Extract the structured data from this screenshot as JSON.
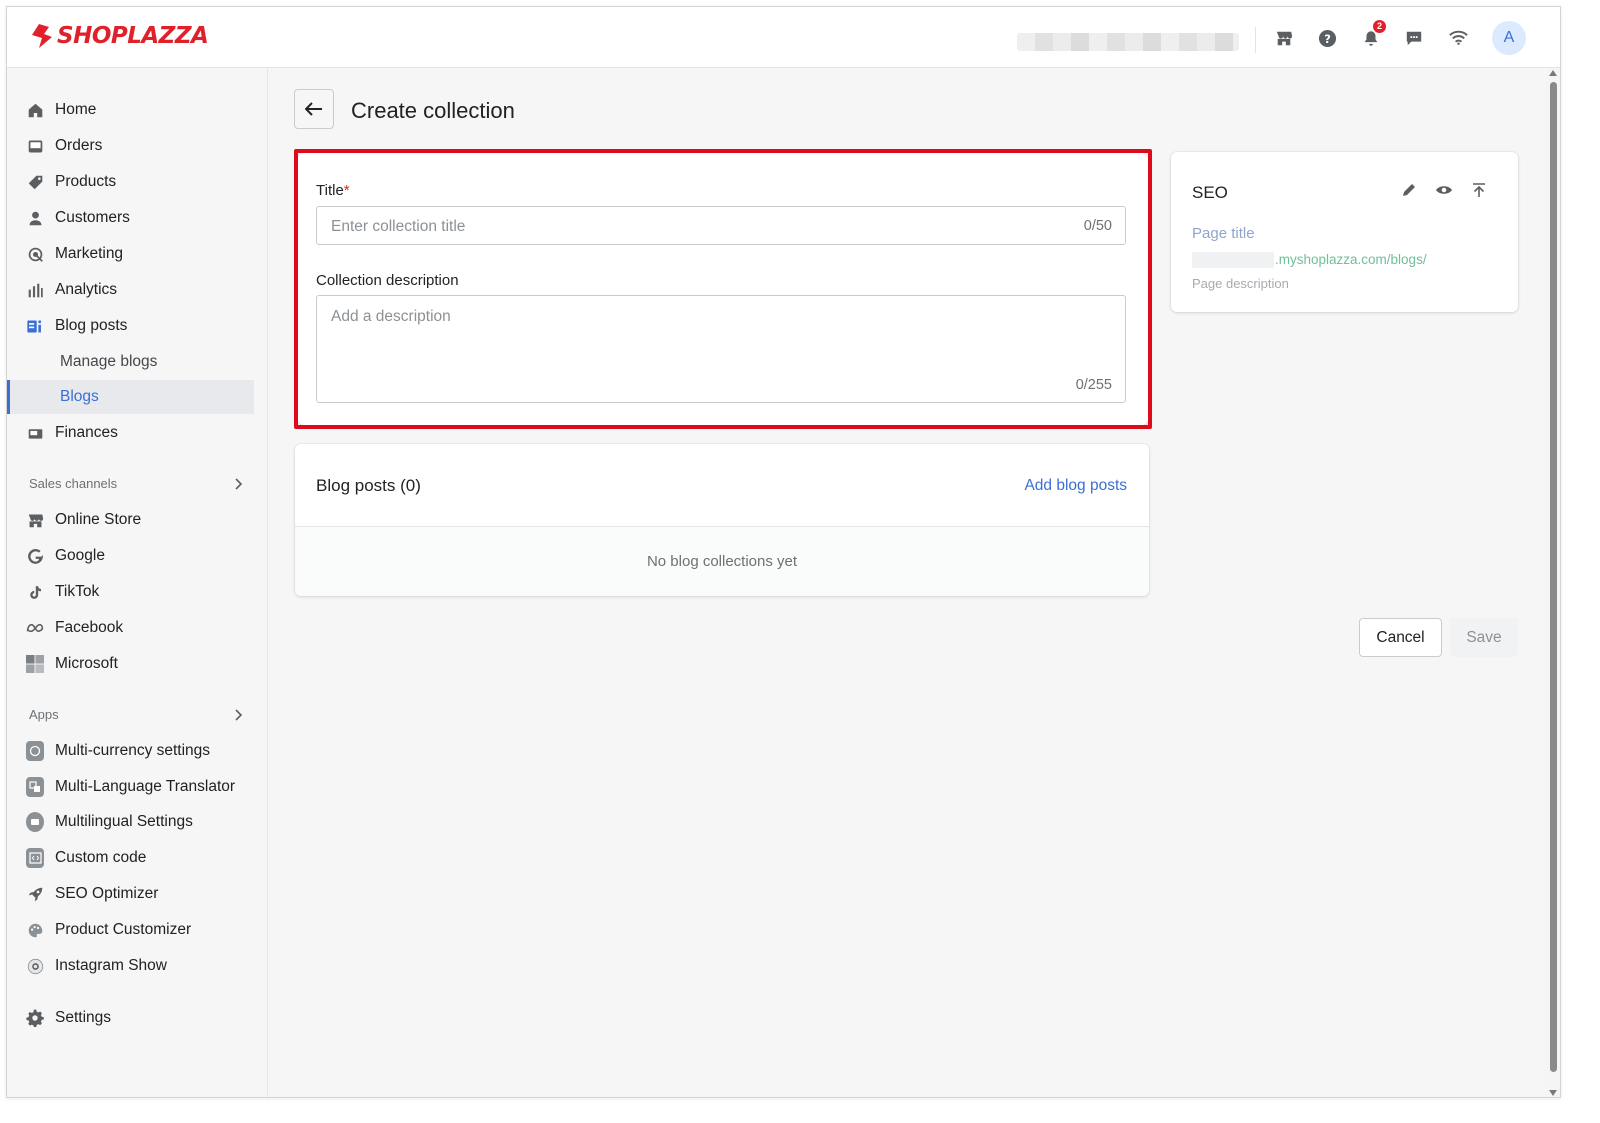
{
  "brand": {
    "name": "SHOPLAZZA",
    "color": "#e0212c"
  },
  "topbar": {
    "icons": [
      "store-icon",
      "help-icon",
      "bell-icon",
      "chat-icon",
      "wifi-icon"
    ],
    "notification_count": "2",
    "avatar_initial": "A"
  },
  "sidebar": {
    "items": [
      {
        "label": "Home",
        "icon": "home-icon"
      },
      {
        "label": "Orders",
        "icon": "orders-icon"
      },
      {
        "label": "Products",
        "icon": "tag-icon"
      },
      {
        "label": "Customers",
        "icon": "person-icon"
      },
      {
        "label": "Marketing",
        "icon": "marketing-icon"
      },
      {
        "label": "Analytics",
        "icon": "bar-chart-icon"
      },
      {
        "label": "Blog posts",
        "icon": "blog-icon"
      },
      {
        "label": "Manage blogs"
      },
      {
        "label": "Blogs"
      },
      {
        "label": "Finances",
        "icon": "finances-icon"
      }
    ],
    "sales_channels_header": "Sales channels",
    "sales_channels": [
      {
        "label": "Online Store",
        "icon": "store-icon"
      },
      {
        "label": "Google",
        "icon": "google-icon"
      },
      {
        "label": "TikTok",
        "icon": "tiktok-icon"
      },
      {
        "label": "Facebook",
        "icon": "meta-icon"
      },
      {
        "label": "Microsoft",
        "icon": "microsoft-icon"
      }
    ],
    "apps_header": "Apps",
    "apps": [
      {
        "label": "Multi-currency settings",
        "icon": "currency-icon"
      },
      {
        "label": "Multi-Language Translator",
        "icon": "translate-icon"
      },
      {
        "label": "Multilingual Settings",
        "icon": "language-icon"
      },
      {
        "label": "Custom code",
        "icon": "code-icon"
      },
      {
        "label": "SEO Optimizer",
        "icon": "rocket-icon"
      },
      {
        "label": "Product Customizer",
        "icon": "palette-icon"
      },
      {
        "label": "Instagram Show",
        "icon": "instagram-icon"
      }
    ],
    "settings": {
      "label": "Settings",
      "icon": "gear-icon"
    }
  },
  "page": {
    "title": "Create collection"
  },
  "form": {
    "title_label": "Title",
    "required_mark": "*",
    "title_placeholder": "Enter collection title",
    "title_counter": "0/50",
    "description_label": "Collection description",
    "description_placeholder": "Add a description",
    "description_counter": "0/255"
  },
  "blog_posts_card": {
    "title": "Blog posts (0)",
    "add_link": "Add blog posts",
    "empty_text": "No blog collections yet"
  },
  "seo_card": {
    "title": "SEO",
    "page_title": "Page title",
    "url_suffix": ".myshoplazza.com/blogs/",
    "page_description": "Page description"
  },
  "actions": {
    "cancel": "Cancel",
    "save": "Save"
  },
  "colors": {
    "accent": "#3b6fd6",
    "highlight": "#dd0b1b"
  }
}
